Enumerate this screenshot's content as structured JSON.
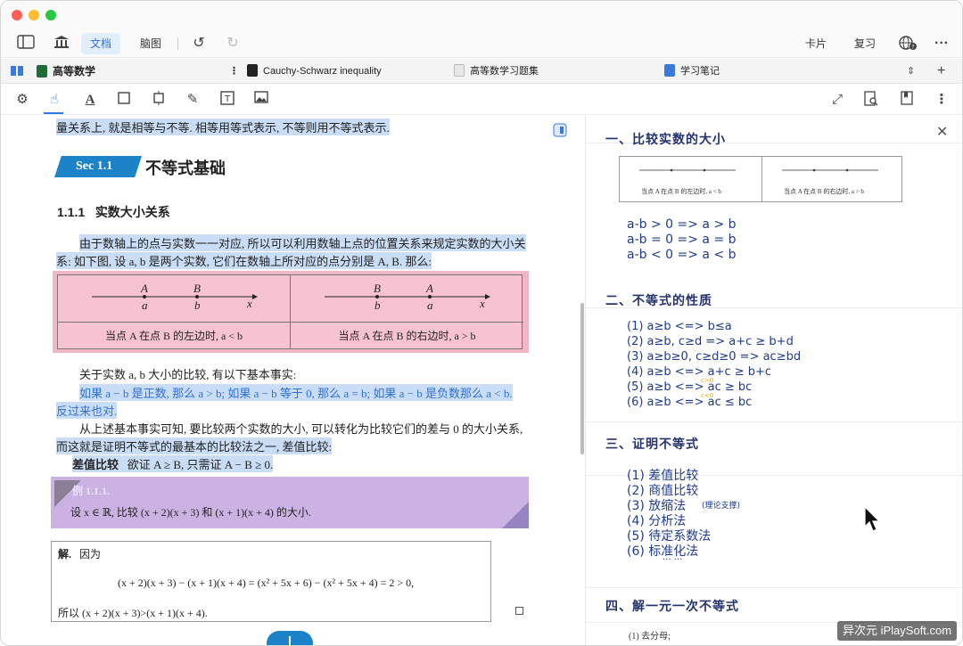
{
  "toolbar": {
    "tab_doc": "文档",
    "tab_mindmap": "脑图",
    "card": "卡片",
    "review": "复习"
  },
  "tabs": [
    {
      "label": "高等数学",
      "color": "#1f6b3a"
    },
    {
      "label": "Cauchy-Schwarz inequality",
      "color": "#222222"
    },
    {
      "label": "高等数学习题集",
      "color": "#cfcfcf"
    },
    {
      "label": "学习笔记",
      "color": "#3a7ad8"
    }
  ],
  "doc": {
    "top_line": "量关系上, 就是相等与不等. 相等用等式表示, 不等则用不等式表示.",
    "sec_badge": "Sec 1.1",
    "sec_title": "不等式基础",
    "sub_number": "1.1.1",
    "sub_title": "实数大小关系",
    "para1_a": "由于数轴上的点与实数一一对应, 所以可以利用数轴上点的位置关系来规定实数的大小关",
    "para1_b": "系: 如下图, 设 a, b 是两个实数, 它们在数轴上所对应的点分别是 A, B. 那么:",
    "fig_left": {
      "A": "A",
      "a": "a",
      "B": "B",
      "b": "b",
      "x": "x",
      "caption": "当点 A 在点 B 的左边时, a < b"
    },
    "fig_right": {
      "A": "A",
      "a": "a",
      "B": "B",
      "b": "b",
      "x": "x",
      "caption": "当点 A 在点 B 的右边时, a > b"
    },
    "fact_intro": "关于实数 a, b 大小的比较, 有以下基本事实:",
    "fact_a": "如果 a − b 是正数, 那么 a > b; 如果 a − b 等于 0, 那么 a = b; 如果 a − b 是负数那么 a < b.",
    "fact_b": "反过来也对.",
    "para2_a": "从上述基本事实可知, 要比较两个实数的大小, 可以转化为比较它们的差与 0 的大小关系,",
    "para2_b": "而这就是证明不等式的最基本的比较法之一, 差值比较:",
    "method_label": "差值比较",
    "method_text": "欲证 A ≥ B, 只需证 A − B ≥ 0.",
    "example_tag": "例 1.1.1.",
    "example_text": "设 x ∈ ℝ, 比较 (x + 2)(x + 3) 和 (x + 1)(x + 4) 的大小.",
    "sol_label": "解.",
    "sol_because": "因为",
    "sol_eq": "(x + 2)(x + 3) − (x + 1)(x + 4) = (x² + 5x + 6) − (x² + 5x + 4) = 2 > 0,",
    "sol_conclusion": "所以 (x + 2)(x + 3)>(x + 1)(x + 4)."
  },
  "notes": {
    "h1": "一、比较实数的大小",
    "fig_cap_left": "当点 A 在点 B 的左边时, a < b",
    "fig_cap_right": "当点 A 在点 B 的右边时, a > b",
    "rules": [
      "a-b > 0  =>  a > b",
      "a-b = 0  =>  a = b",
      "a-b < 0  =>  a < b"
    ],
    "h2": "二、不等式的性质",
    "props": [
      "(1) a≥b <=> b≤a",
      "(2) a≥b, c≥d => a+c ≥ b+d",
      "(3) a≥b≥0, c≥d≥0 => ac≥bd",
      "(4) a≥b <=> a+c ≥ b+c",
      "(5) a≥b <=> ac ≥ bc",
      "(6) a≥b <=> ac ≤ bc"
    ],
    "prop5_note": "c>0",
    "prop6_note": "c<0",
    "h3": "三、证明不等式",
    "methods": [
      "(1) 差值比较",
      "(2) 商值比较",
      "(3) 放缩法",
      "(4) 分析法",
      "(5) 待定系数法",
      "(6) 标准化法"
    ],
    "method3_note": "(理论支撑)",
    "ellipsis": "...  ...",
    "h4": "四、解一元一次不等式",
    "last": "(1) 去分母;"
  },
  "watermark": "异次元 iPlaySoft.com"
}
